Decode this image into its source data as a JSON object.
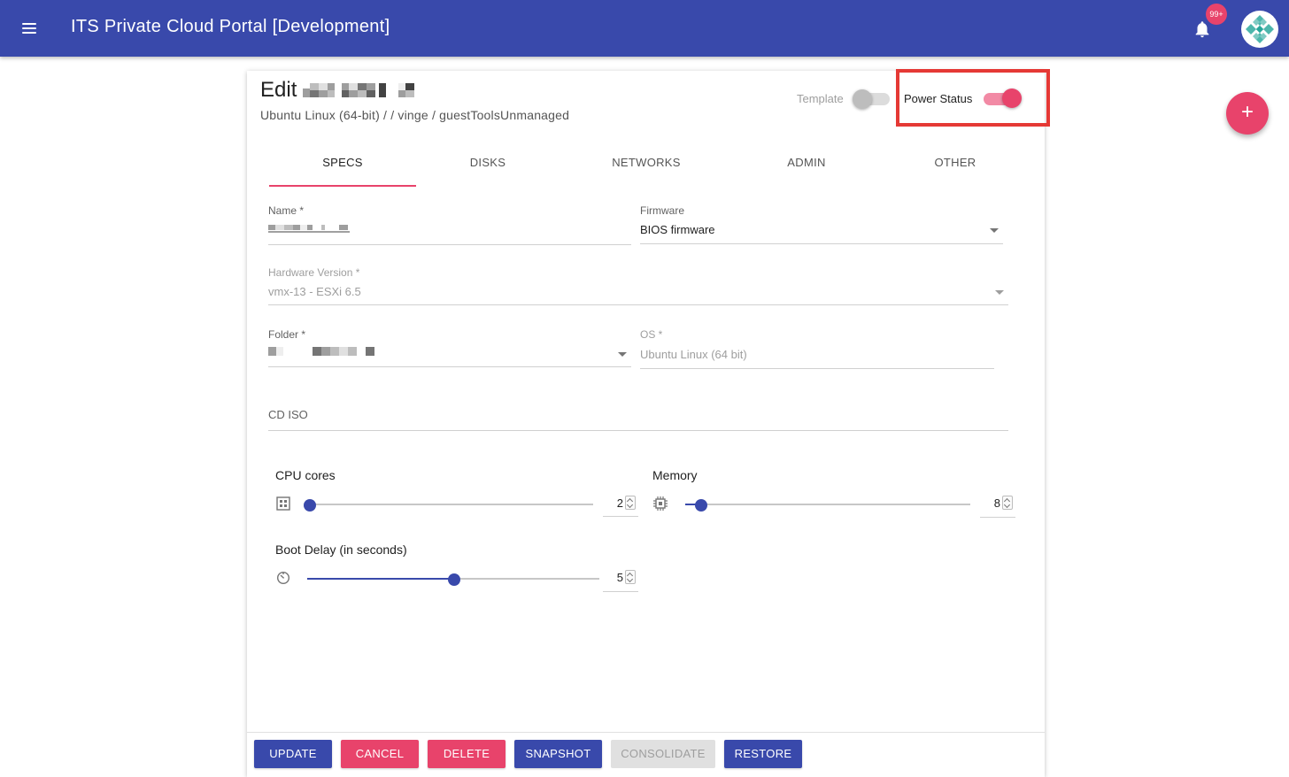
{
  "app": {
    "title": "ITS Private Cloud Portal [Development]",
    "notification_count": "99+",
    "brand_color": "#3949ab",
    "accent_color": "#e8436b"
  },
  "header": {
    "edit_label": "Edit",
    "subtitle": "Ubuntu Linux (64-bit) / / vinge / guestToolsUnmanaged",
    "template_label": "Template",
    "template_on": false,
    "power_label": "Power Status",
    "power_on": true
  },
  "tabs": [
    {
      "label": "SPECS",
      "active": true
    },
    {
      "label": "DISKS",
      "active": false
    },
    {
      "label": "NETWORKS",
      "active": false
    },
    {
      "label": "ADMIN",
      "active": false
    },
    {
      "label": "OTHER",
      "active": false
    }
  ],
  "form": {
    "name_label": "Name *",
    "firmware_label": "Firmware",
    "firmware_value": "BIOS firmware",
    "hardware_label": "Hardware Version *",
    "hardware_value": "vmx-13 - ESXi 6.5",
    "folder_label": "Folder *",
    "os_label": "OS *",
    "os_value": "Ubuntu Linux (64 bit)",
    "cd_iso_placeholder": "CD ISO"
  },
  "resources": {
    "cpu_label": "CPU cores",
    "cpu_value": "2",
    "memory_label": "Memory",
    "memory_value": "8",
    "boot_delay_label": "Boot Delay (in seconds)",
    "boot_delay_value": "5"
  },
  "actions": {
    "update": "UPDATE",
    "cancel": "CANCEL",
    "delete": "DELETE",
    "snapshot": "SNAPSHOT",
    "consolidate": "CONSOLIDATE",
    "restore": "RESTORE"
  },
  "icons": {
    "menu": "menu-icon",
    "bell": "bell-icon",
    "avatar": "avatar-logo",
    "add": "add-icon",
    "cpu": "cpu-icon",
    "memory": "memory-chip-icon",
    "timer": "timer-icon"
  },
  "fab_label": "+"
}
